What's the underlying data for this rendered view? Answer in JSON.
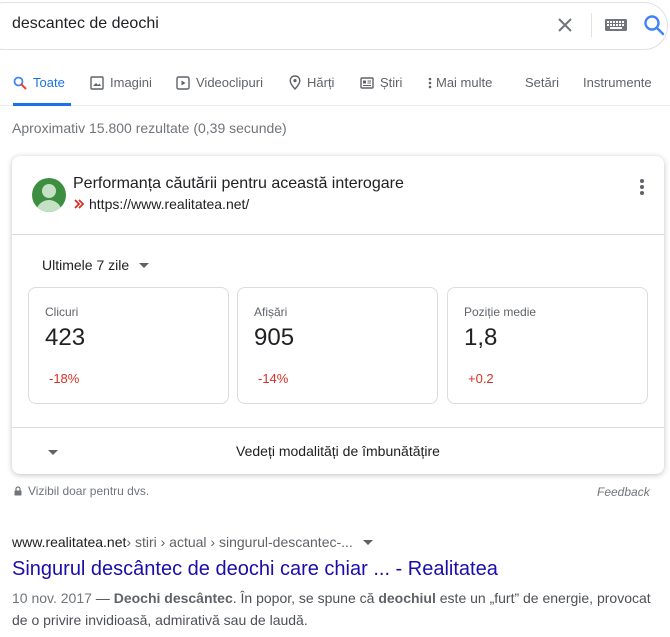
{
  "search": {
    "query": "descantec de deochi"
  },
  "tabs": [
    {
      "label": "Toate",
      "icon": "search-icon",
      "active": true
    },
    {
      "label": "Imagini",
      "icon": "image-icon"
    },
    {
      "label": "Videoclipuri",
      "icon": "video-icon"
    },
    {
      "label": "Hărți",
      "icon": "map-pin-icon"
    },
    {
      "label": "Știri",
      "icon": "news-icon"
    },
    {
      "label": "Mai multe",
      "icon": "more-vert-icon"
    },
    {
      "label": "Setări"
    },
    {
      "label": "Instrumente"
    }
  ],
  "results_stats": "Aproximativ 15.800 rezultate (0,39 secunde)",
  "performance_card": {
    "title": "Performanța căutării pentru această interogare",
    "url": "https://www.realitatea.net/",
    "period": "Ultimele 7 zile",
    "metrics": [
      {
        "label": "Clicuri",
        "value": "423",
        "delta": "-18%",
        "delta_color": "#d93025"
      },
      {
        "label": "Afișări",
        "value": "905",
        "delta": "-14%",
        "delta_color": "#d93025"
      },
      {
        "label": "Poziție medie",
        "value": "1,8",
        "delta": "+0.2",
        "delta_color": "#d93025"
      }
    ],
    "improve_label": "Vedeți modalități de îmbunătățire"
  },
  "visibility_note": "Vizibil doar pentru dvs.",
  "feedback_label": "Feedback",
  "result": {
    "site": "www.realitatea.net",
    "path": " › stiri › actual › singurul-descantec-...",
    "title": "Singurul descântec de deochi care chiar ... - Realitatea",
    "date": "10 nov. 2017",
    "dash": " — ",
    "snippet_b1": "Deochi descântec",
    "snippet_t1": ". În popor, se spune că ",
    "snippet_b2": "deochiul",
    "snippet_t2": " este un „furt” de energie, provocat de o privire invidioasă, admirativă sau de laudă."
  },
  "colors": {
    "accent": "#1a73e8",
    "link": "#1a0dab",
    "negative": "#d93025"
  }
}
